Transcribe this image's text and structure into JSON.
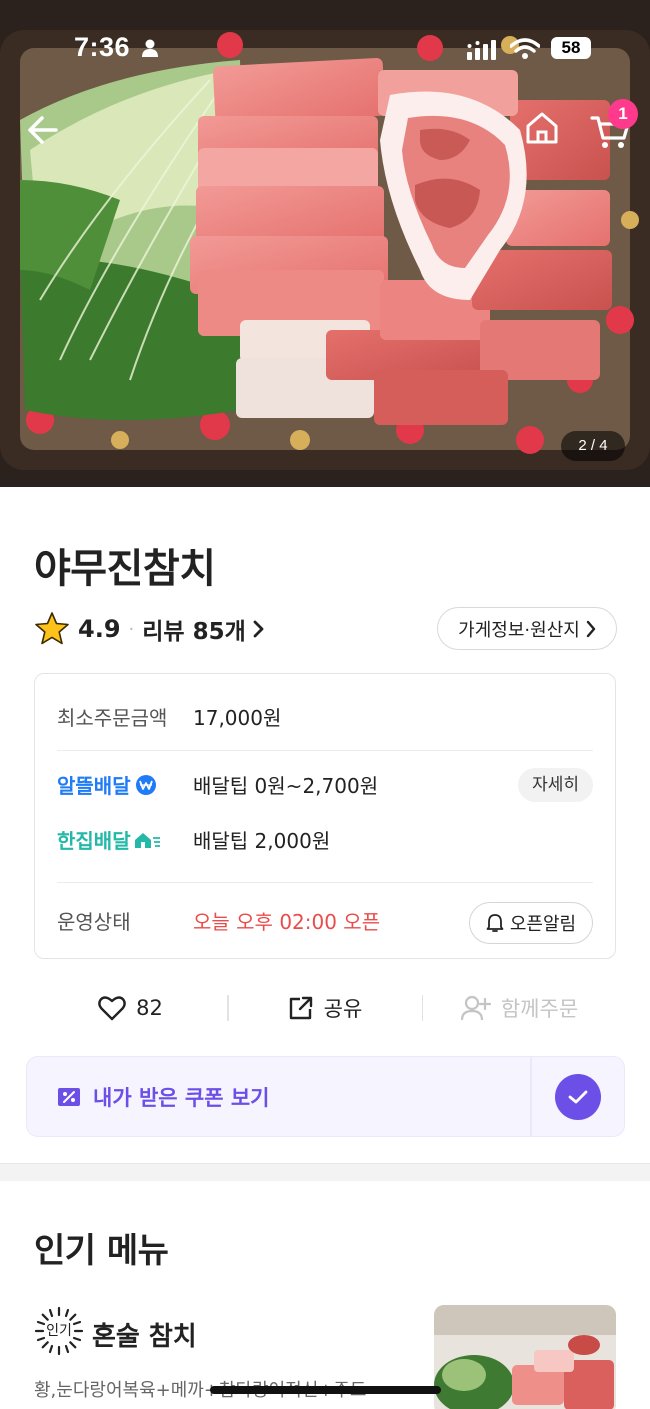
{
  "status_bar": {
    "time": "7:36",
    "battery": "58"
  },
  "hero": {
    "pager": "2 / 4",
    "cart_count": "1"
  },
  "store": {
    "name": "야무진참치",
    "rating": "4.9",
    "review_label": "리뷰 85개",
    "info_button": "가게정보·원산지"
  },
  "info_card": {
    "min_order_label": "최소주문금액",
    "min_order_value": "17,000원",
    "saver_delivery_label": "알뜰배달",
    "saver_delivery_fee": "배달팁 0원~2,700원",
    "detail_chip": "자세히",
    "single_delivery_label": "한집배달",
    "single_delivery_fee": "배달팁 2,000원",
    "status_label": "운영상태",
    "status_value": "오늘 오후 02:00 오픈",
    "alarm_button": "오픈알림"
  },
  "actions": {
    "likes": "82",
    "share": "공유",
    "group_order": "함께주문"
  },
  "coupon": {
    "label": "내가 받은 쿠폰 보기"
  },
  "popular": {
    "title": "인기 메뉴",
    "badge": "인기",
    "item_name": "혼술 참치",
    "item_desc": "황,눈다랑어복육+메까+참다랑어적신+주도"
  },
  "colors": {
    "accent_purple": "#6c4fe6",
    "saver_blue": "#1f7bf6",
    "single_teal": "#23b8a8",
    "status_red": "#ea4b4b",
    "badge_pink": "#ff3a8c"
  }
}
